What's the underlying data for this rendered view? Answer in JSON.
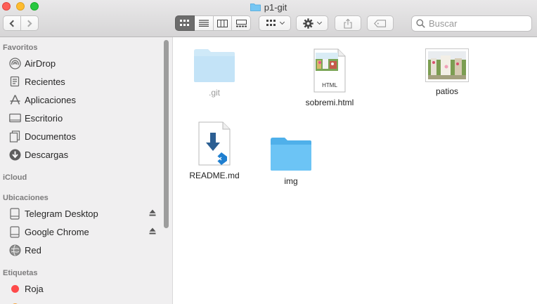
{
  "window": {
    "title": "p1-git"
  },
  "toolbar": {
    "view_modes": [
      "icon-view",
      "list-view",
      "column-view",
      "gallery-view"
    ],
    "active_view": "icon-view",
    "search_placeholder": "Buscar"
  },
  "sidebar": {
    "favorites_title": "Favoritos",
    "favorites": [
      {
        "label": "AirDrop",
        "icon": "airdrop-icon"
      },
      {
        "label": "Recientes",
        "icon": "recents-icon"
      },
      {
        "label": "Aplicaciones",
        "icon": "applications-icon"
      },
      {
        "label": "Escritorio",
        "icon": "desktop-icon"
      },
      {
        "label": "Documentos",
        "icon": "documents-icon"
      },
      {
        "label": "Descargas",
        "icon": "downloads-icon"
      }
    ],
    "icloud_title": "iCloud",
    "locations_title": "Ubicaciones",
    "locations": [
      {
        "label": "Telegram Desktop",
        "icon": "disk-icon",
        "eject": true
      },
      {
        "label": "Google Chrome",
        "icon": "disk-icon",
        "eject": true
      },
      {
        "label": "Red",
        "icon": "network-icon",
        "eject": false
      }
    ],
    "tags_title": "Etiquetas",
    "tags": [
      {
        "label": "Roja",
        "color": "#fe4a4a"
      }
    ]
  },
  "files": [
    {
      "name": ".git",
      "kind": "folder",
      "dimmed": true
    },
    {
      "name": "sobremi.html",
      "kind": "html-document",
      "badge": "HTML"
    },
    {
      "name": "patios",
      "kind": "image"
    },
    {
      "name": "README.md",
      "kind": "markdown-document"
    },
    {
      "name": "img",
      "kind": "folder",
      "dimmed": false
    }
  ],
  "colors": {
    "folder_blue": "#6cc4f5",
    "selection_gray": "#6c6c6c",
    "vscode_blue": "#1f7fd0"
  }
}
